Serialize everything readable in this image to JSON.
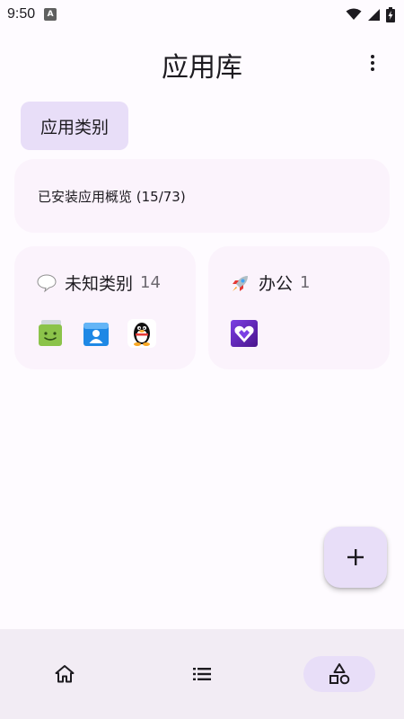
{
  "status_bar": {
    "time": "9:50",
    "notification_icon": "a-icon",
    "icons": [
      "wifi-icon",
      "signal-icon",
      "battery-charging-icon"
    ]
  },
  "header": {
    "title": "应用库",
    "menu_icon": "more-vert-icon"
  },
  "chip": {
    "label": "应用类别"
  },
  "overview": {
    "label": "已安装应用概览 (15/73)"
  },
  "categories": [
    {
      "emoji": "speech-bubble-icon",
      "name": "未知类别",
      "count": "14",
      "apps": [
        "green-message-app-icon",
        "blue-contacts-app-icon",
        "qq-penguin-app-icon"
      ]
    },
    {
      "emoji": "rocket-icon",
      "name": "办公",
      "count": "1",
      "apps": [
        "purple-heart-app-icon"
      ]
    }
  ],
  "fab": {
    "icon": "plus-icon"
  },
  "bottom_nav": {
    "items": [
      {
        "icon": "home-icon",
        "selected": false
      },
      {
        "icon": "list-icon",
        "selected": false
      },
      {
        "icon": "shapes-icon",
        "selected": true
      }
    ]
  },
  "colors": {
    "background": "#fefbff",
    "accent": "#e8def8",
    "card": "#fbf3fc",
    "nav_bar": "#f2ecf4",
    "text": "#1d1b20"
  }
}
